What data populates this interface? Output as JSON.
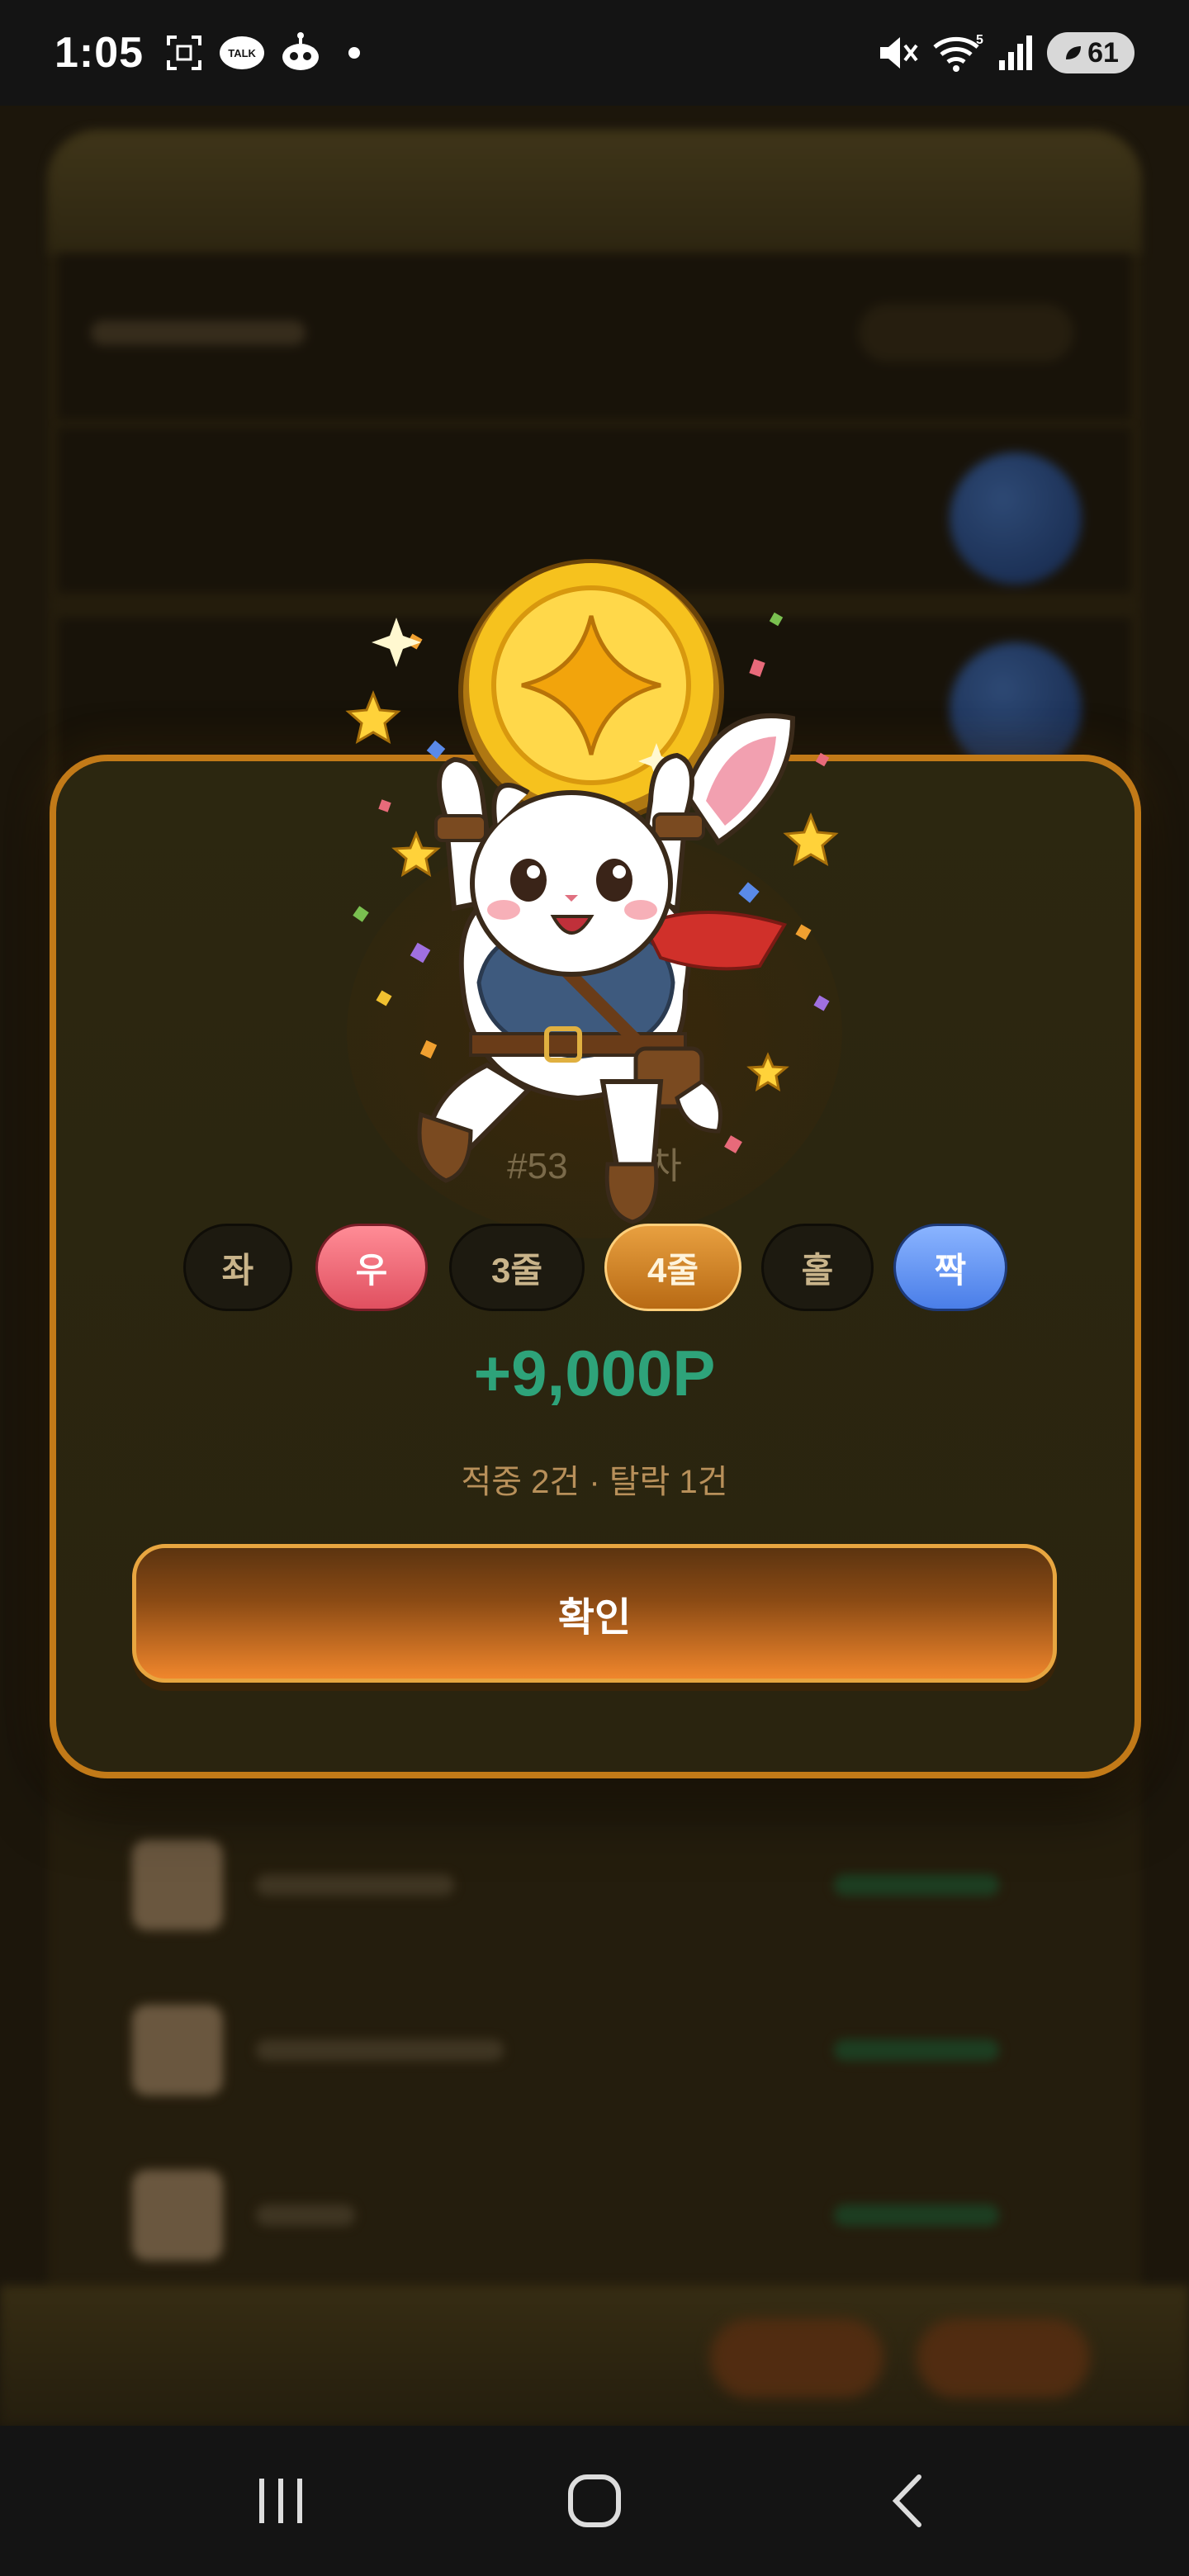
{
  "status_bar": {
    "time": "1:05",
    "talk_label": "TALK",
    "network": "5",
    "battery": "61"
  },
  "modal": {
    "round_label": "#53",
    "round_suffix": "차",
    "chips": [
      {
        "label": "좌",
        "style": "dark"
      },
      {
        "label": "우",
        "style": "red"
      },
      {
        "label": "3줄",
        "style": "dark"
      },
      {
        "label": "4줄",
        "style": "gold"
      },
      {
        "label": "홀",
        "style": "dark"
      },
      {
        "label": "짝",
        "style": "blue"
      }
    ],
    "reward": "+9,000P",
    "summary": "적중 2건 · 탈락 1건",
    "confirm_label": "확인"
  },
  "colors": {
    "accent_orange": "#c27a18",
    "reward_green": "#2ea37a",
    "chip_red": "#e05060",
    "chip_blue": "#4a7ee8",
    "chip_gold": "#b86a14"
  },
  "icons": {
    "status_left": [
      "screenshot-icon",
      "kakaotalk-icon",
      "alien-app-icon",
      "notification-dot-icon"
    ],
    "status_right": [
      "mute-icon",
      "wifi-icon",
      "signal-icon",
      "battery-icon"
    ],
    "nav": [
      "recent-apps-icon",
      "home-icon",
      "back-icon"
    ]
  }
}
